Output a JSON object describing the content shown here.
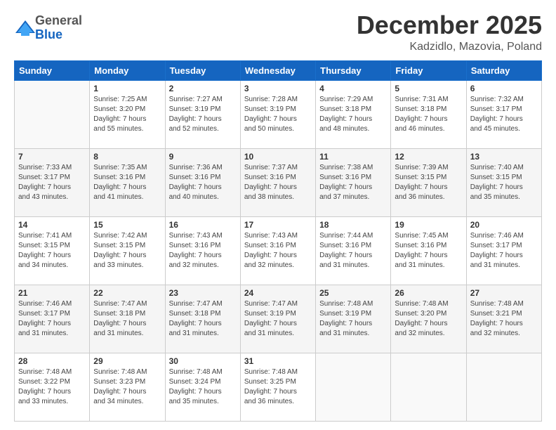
{
  "logo": {
    "general": "General",
    "blue": "Blue"
  },
  "header": {
    "month": "December 2025",
    "location": "Kadzidlo, Mazovia, Poland"
  },
  "weekdays": [
    "Sunday",
    "Monday",
    "Tuesday",
    "Wednesday",
    "Thursday",
    "Friday",
    "Saturday"
  ],
  "weeks": [
    [
      {
        "day": "",
        "info": ""
      },
      {
        "day": "1",
        "info": "Sunrise: 7:25 AM\nSunset: 3:20 PM\nDaylight: 7 hours\nand 55 minutes."
      },
      {
        "day": "2",
        "info": "Sunrise: 7:27 AM\nSunset: 3:19 PM\nDaylight: 7 hours\nand 52 minutes."
      },
      {
        "day": "3",
        "info": "Sunrise: 7:28 AM\nSunset: 3:19 PM\nDaylight: 7 hours\nand 50 minutes."
      },
      {
        "day": "4",
        "info": "Sunrise: 7:29 AM\nSunset: 3:18 PM\nDaylight: 7 hours\nand 48 minutes."
      },
      {
        "day": "5",
        "info": "Sunrise: 7:31 AM\nSunset: 3:18 PM\nDaylight: 7 hours\nand 46 minutes."
      },
      {
        "day": "6",
        "info": "Sunrise: 7:32 AM\nSunset: 3:17 PM\nDaylight: 7 hours\nand 45 minutes."
      }
    ],
    [
      {
        "day": "7",
        "info": "Sunrise: 7:33 AM\nSunset: 3:17 PM\nDaylight: 7 hours\nand 43 minutes."
      },
      {
        "day": "8",
        "info": "Sunrise: 7:35 AM\nSunset: 3:16 PM\nDaylight: 7 hours\nand 41 minutes."
      },
      {
        "day": "9",
        "info": "Sunrise: 7:36 AM\nSunset: 3:16 PM\nDaylight: 7 hours\nand 40 minutes."
      },
      {
        "day": "10",
        "info": "Sunrise: 7:37 AM\nSunset: 3:16 PM\nDaylight: 7 hours\nand 38 minutes."
      },
      {
        "day": "11",
        "info": "Sunrise: 7:38 AM\nSunset: 3:16 PM\nDaylight: 7 hours\nand 37 minutes."
      },
      {
        "day": "12",
        "info": "Sunrise: 7:39 AM\nSunset: 3:15 PM\nDaylight: 7 hours\nand 36 minutes."
      },
      {
        "day": "13",
        "info": "Sunrise: 7:40 AM\nSunset: 3:15 PM\nDaylight: 7 hours\nand 35 minutes."
      }
    ],
    [
      {
        "day": "14",
        "info": "Sunrise: 7:41 AM\nSunset: 3:15 PM\nDaylight: 7 hours\nand 34 minutes."
      },
      {
        "day": "15",
        "info": "Sunrise: 7:42 AM\nSunset: 3:15 PM\nDaylight: 7 hours\nand 33 minutes."
      },
      {
        "day": "16",
        "info": "Sunrise: 7:43 AM\nSunset: 3:16 PM\nDaylight: 7 hours\nand 32 minutes."
      },
      {
        "day": "17",
        "info": "Sunrise: 7:43 AM\nSunset: 3:16 PM\nDaylight: 7 hours\nand 32 minutes."
      },
      {
        "day": "18",
        "info": "Sunrise: 7:44 AM\nSunset: 3:16 PM\nDaylight: 7 hours\nand 31 minutes."
      },
      {
        "day": "19",
        "info": "Sunrise: 7:45 AM\nSunset: 3:16 PM\nDaylight: 7 hours\nand 31 minutes."
      },
      {
        "day": "20",
        "info": "Sunrise: 7:46 AM\nSunset: 3:17 PM\nDaylight: 7 hours\nand 31 minutes."
      }
    ],
    [
      {
        "day": "21",
        "info": "Sunrise: 7:46 AM\nSunset: 3:17 PM\nDaylight: 7 hours\nand 31 minutes."
      },
      {
        "day": "22",
        "info": "Sunrise: 7:47 AM\nSunset: 3:18 PM\nDaylight: 7 hours\nand 31 minutes."
      },
      {
        "day": "23",
        "info": "Sunrise: 7:47 AM\nSunset: 3:18 PM\nDaylight: 7 hours\nand 31 minutes."
      },
      {
        "day": "24",
        "info": "Sunrise: 7:47 AM\nSunset: 3:19 PM\nDaylight: 7 hours\nand 31 minutes."
      },
      {
        "day": "25",
        "info": "Sunrise: 7:48 AM\nSunset: 3:19 PM\nDaylight: 7 hours\nand 31 minutes."
      },
      {
        "day": "26",
        "info": "Sunrise: 7:48 AM\nSunset: 3:20 PM\nDaylight: 7 hours\nand 32 minutes."
      },
      {
        "day": "27",
        "info": "Sunrise: 7:48 AM\nSunset: 3:21 PM\nDaylight: 7 hours\nand 32 minutes."
      }
    ],
    [
      {
        "day": "28",
        "info": "Sunrise: 7:48 AM\nSunset: 3:22 PM\nDaylight: 7 hours\nand 33 minutes."
      },
      {
        "day": "29",
        "info": "Sunrise: 7:48 AM\nSunset: 3:23 PM\nDaylight: 7 hours\nand 34 minutes."
      },
      {
        "day": "30",
        "info": "Sunrise: 7:48 AM\nSunset: 3:24 PM\nDaylight: 7 hours\nand 35 minutes."
      },
      {
        "day": "31",
        "info": "Sunrise: 7:48 AM\nSunset: 3:25 PM\nDaylight: 7 hours\nand 36 minutes."
      },
      {
        "day": "",
        "info": ""
      },
      {
        "day": "",
        "info": ""
      },
      {
        "day": "",
        "info": ""
      }
    ]
  ]
}
